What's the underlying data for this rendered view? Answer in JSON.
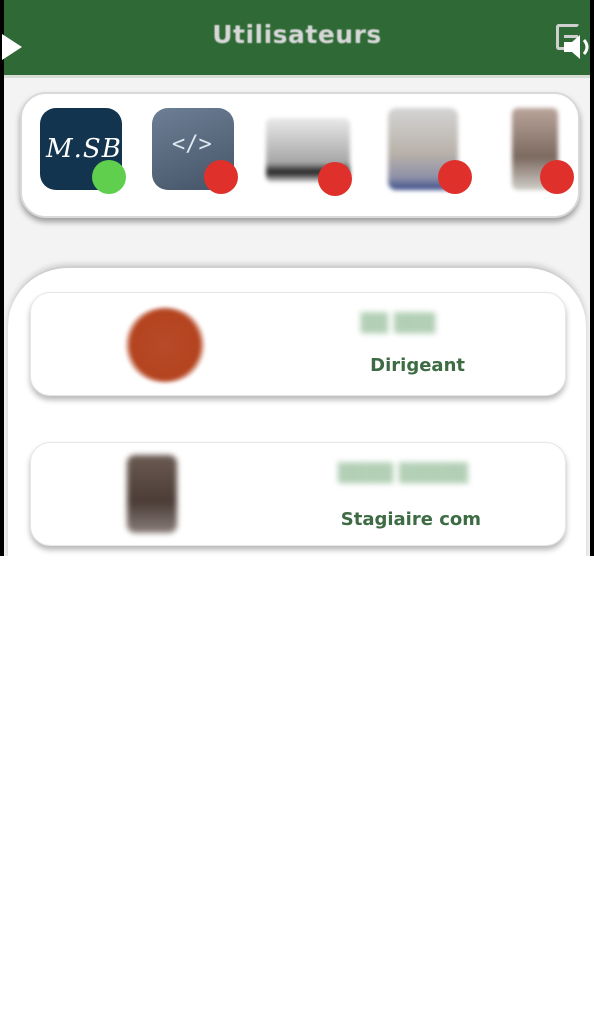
{
  "header": {
    "title": "Utilisateurs",
    "icons": {
      "logout": "logout-icon",
      "play": "play-icon",
      "volume": "volume-icon"
    }
  },
  "online_strip": {
    "users": [
      {
        "tile": "M.SB",
        "status": "online",
        "status_color": "#5fcf4d"
      },
      {
        "tile": "</>",
        "status": "offline",
        "status_color": "#e0302b"
      },
      {
        "tile": "",
        "status": "offline",
        "status_color": "#e0302b"
      },
      {
        "tile": "",
        "status": "offline",
        "status_color": "#e0302b"
      },
      {
        "tile": "",
        "status": "offline",
        "status_color": "#e0302b"
      }
    ]
  },
  "user_list": [
    {
      "role": "Dirigeant"
    },
    {
      "role": "Stagiaire com"
    }
  ],
  "colors": {
    "header_bg": "#2f6a36",
    "role_text": "#3d6b43",
    "online": "#5fcf4d",
    "offline": "#e0302b"
  }
}
